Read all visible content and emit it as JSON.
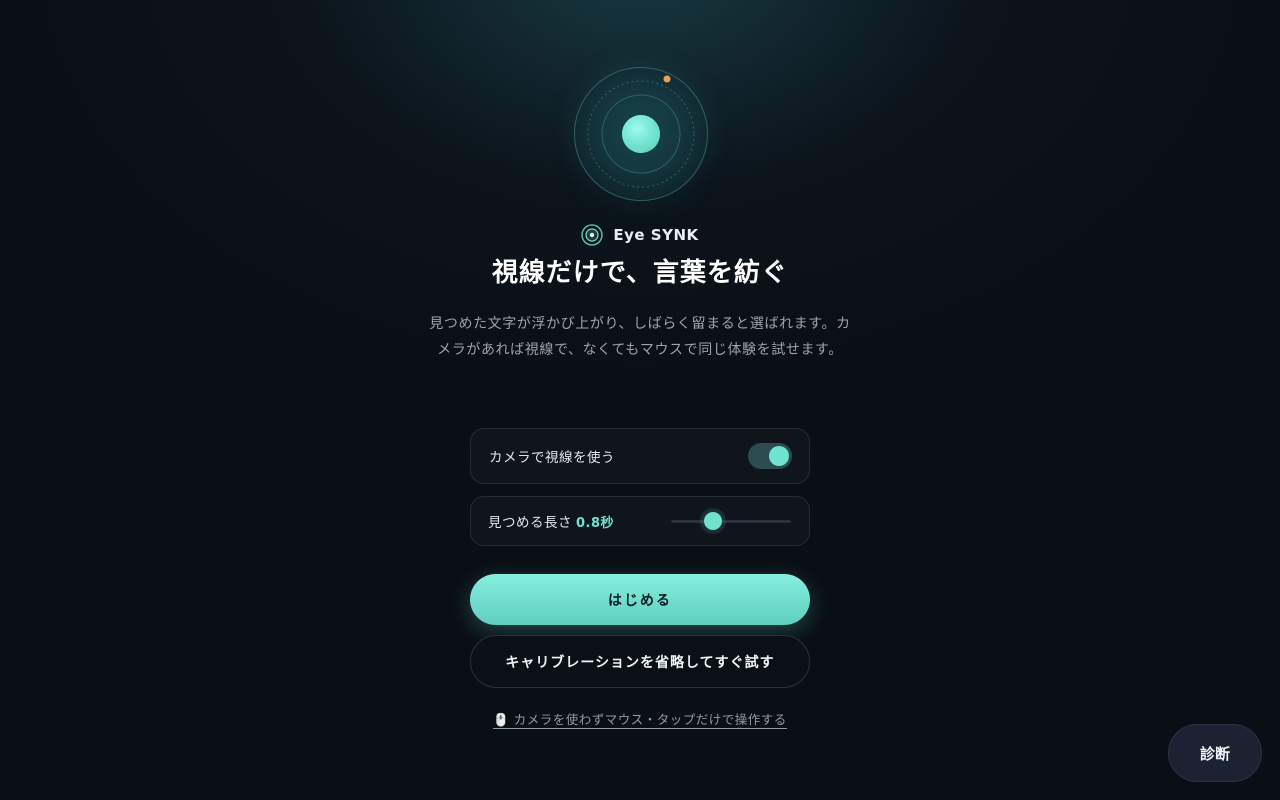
{
  "brand": {
    "name": "Eye SYNK",
    "icon": "eye-logo-icon"
  },
  "hero": {
    "icon": "gaze-orb-icon",
    "title": "視線だけで、言葉を紡ぐ",
    "description": "見つめた文字が浮かび上がり、しばらく留まると選ばれます。カメラがあれば視線で、なくてもマウスで同じ体験を試せます。"
  },
  "settings": {
    "camera": {
      "label": "カメラで視線を使う",
      "enabled": true
    },
    "dwell": {
      "label": "見つめる長さ",
      "value": "0.8秒",
      "slider_fraction": 0.35
    }
  },
  "actions": {
    "start_label": "はじめる",
    "skip_label": "キャリブレーションを省略してすぐ試す",
    "mouse_only_icon": "mouse-icon",
    "mouse_only_label": "🖱️ カメラを使わずマウス・タップだけで操作する"
  },
  "diagnostics": {
    "label": "診断"
  },
  "colors": {
    "accent": "#6fe3cf",
    "background": "#0a0f15",
    "card": "#10151c",
    "orbit_dot": "#f0a050"
  }
}
